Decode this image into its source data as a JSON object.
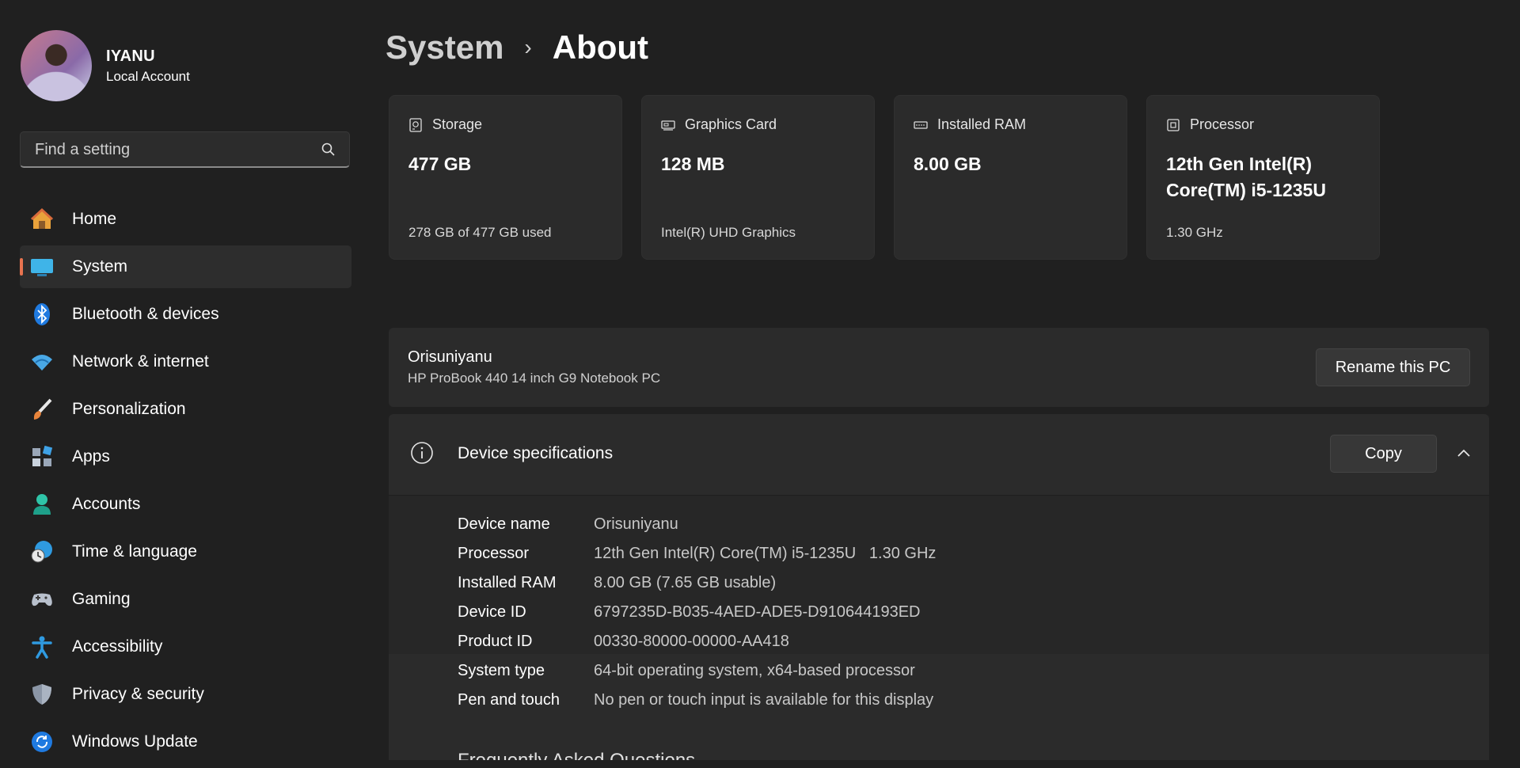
{
  "profile": {
    "name": "IYANU",
    "account_type": "Local Account"
  },
  "search": {
    "placeholder": "Find a setting"
  },
  "nav": [
    {
      "label": "Home",
      "icon": "home-icon"
    },
    {
      "label": "System",
      "icon": "monitor-icon",
      "active": true
    },
    {
      "label": "Bluetooth & devices",
      "icon": "bluetooth-icon"
    },
    {
      "label": "Network & internet",
      "icon": "wifi-icon"
    },
    {
      "label": "Personalization",
      "icon": "brush-icon"
    },
    {
      "label": "Apps",
      "icon": "apps-icon"
    },
    {
      "label": "Accounts",
      "icon": "person-icon"
    },
    {
      "label": "Time & language",
      "icon": "globe-clock-icon"
    },
    {
      "label": "Gaming",
      "icon": "gamepad-icon"
    },
    {
      "label": "Accessibility",
      "icon": "accessibility-icon"
    },
    {
      "label": "Privacy & security",
      "icon": "shield-icon"
    },
    {
      "label": "Windows Update",
      "icon": "update-icon"
    }
  ],
  "breadcrumb": {
    "parent": "System",
    "separator": "›",
    "current": "About"
  },
  "cards": {
    "storage": {
      "title": "Storage",
      "value": "477 GB",
      "sub": "278 GB of 477 GB used"
    },
    "graphics": {
      "title": "Graphics Card",
      "value": "128 MB",
      "sub": "Intel(R) UHD Graphics"
    },
    "ram": {
      "title": "Installed RAM",
      "value": "8.00 GB",
      "sub": ""
    },
    "processor": {
      "title": "Processor",
      "value": "12th Gen Intel(R) Core(TM) i5-1235U",
      "sub": "1.30 GHz"
    }
  },
  "pc": {
    "name": "Orisuniyanu",
    "model": "HP ProBook 440 14 inch G9 Notebook PC",
    "rename_label": "Rename this PC"
  },
  "specs": {
    "title": "Device specifications",
    "copy_label": "Copy",
    "rows": [
      {
        "label": "Device name",
        "value": "Orisuniyanu"
      },
      {
        "label": "Processor",
        "value": "12th Gen Intel(R) Core(TM) i5-1235U   1.30 GHz"
      },
      {
        "label": "Installed RAM",
        "value": "8.00 GB (7.65 GB usable)"
      },
      {
        "label": "Device ID",
        "value": "6797235D-B035-4AED-ADE5-D910644193ED"
      },
      {
        "label": "Product ID",
        "value": "00330-80000-00000-AA418"
      },
      {
        "label": "System type",
        "value": "64-bit operating system, x64-based processor"
      },
      {
        "label": "Pen and touch",
        "value": "No pen or touch input is available for this display"
      }
    ],
    "faq_title": "Frequently Asked Questions"
  },
  "colors": {
    "accent": "#e8734f",
    "background": "#202020",
    "panel": "#2b2b2b"
  }
}
